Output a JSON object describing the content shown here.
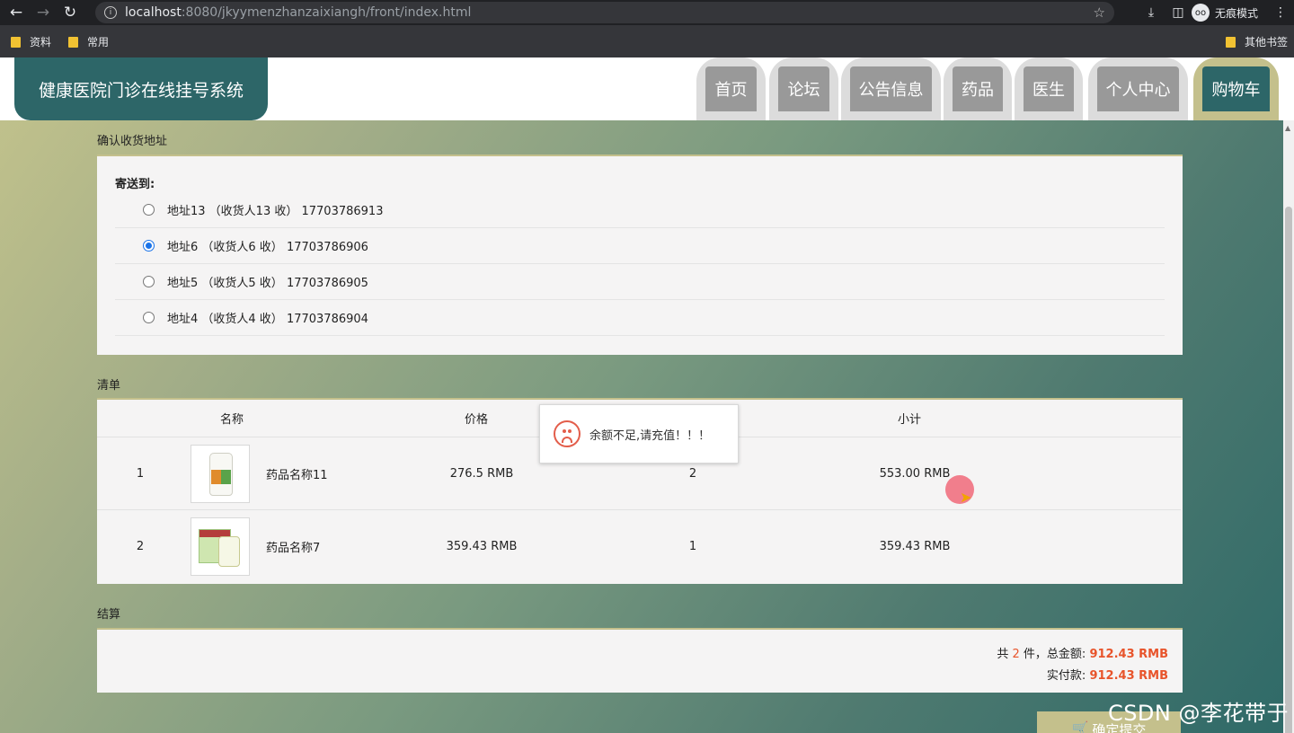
{
  "browser": {
    "url_host": "localhost",
    "url_path": ":8080/jkyymenzhanzaixiangh/front/index.html",
    "incognito_label": "无痕模式",
    "bookmarks": [
      "资料",
      "常用"
    ],
    "other_bookmarks": "其他书签"
  },
  "header": {
    "logo": "健康医院门诊在线挂号系统",
    "nav": [
      "首页",
      "论坛",
      "公告信息",
      "药品",
      "医生",
      "个人中心",
      "购物车"
    ],
    "active_nav": "购物车"
  },
  "address": {
    "section_title": "确认收货地址",
    "ship_to_label": "寄送到:",
    "options": [
      {
        "text": "地址13 （收货人13 收） 17703786913",
        "selected": false
      },
      {
        "text": "地址6 （收货人6 收） 17703786906",
        "selected": true
      },
      {
        "text": "地址5 （收货人5 收） 17703786905",
        "selected": false
      },
      {
        "text": "地址4 （收货人4 收） 17703786904",
        "selected": false
      }
    ]
  },
  "list": {
    "section_title": "清单",
    "columns": {
      "name": "名称",
      "price": "价格",
      "subtotal": "小计"
    },
    "rows": [
      {
        "index": "1",
        "name": "药品名称11",
        "price": "276.5 RMB",
        "qty": "2",
        "subtotal": "553.00 RMB"
      },
      {
        "index": "2",
        "name": "药品名称7",
        "price": "359.43 RMB",
        "qty": "1",
        "subtotal": "359.43 RMB"
      }
    ]
  },
  "settle": {
    "section_title": "结算",
    "count_prefix": "共",
    "count": "2",
    "count_suffix": "件，总金额:",
    "total": "912.43 RMB",
    "paid_label": "实付款:",
    "paid": "912.43 RMB",
    "submit_label": "确定提交"
  },
  "toast": {
    "message": "余额不足,请充值！！！"
  },
  "watermark": "CSDN @李花带于"
}
